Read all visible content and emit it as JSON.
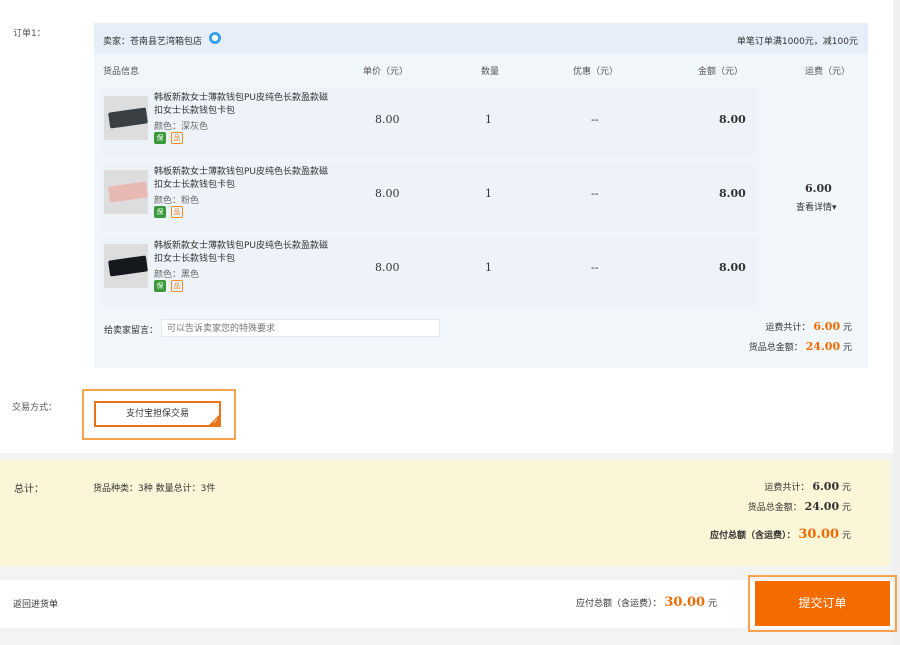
{
  "order": {
    "label": "订单1：",
    "seller": "卖家：苍南县艺湾箱包店",
    "promo": "单笔订单满1000元，减100元",
    "headers": {
      "info": "货品信息",
      "unit_price": "单价（元）",
      "quantity": "数量",
      "discount": "优惠（元）",
      "amount": "金额（元）",
      "shipping": "运费（元）"
    },
    "items": [
      {
        "title": "韩板新款女士薄款钱包PU皮纯色长款盈款磁扣女士长款钱包卡包",
        "attr": "颜色：深灰色",
        "badge1": "保",
        "badge2": "品",
        "unit_price": "8.00",
        "quantity": "1",
        "discount": "--",
        "amount": "8.00",
        "wallet_color": "#3a3f44"
      },
      {
        "title": "韩板新款女士薄款钱包PU皮纯色长款盈款磁扣女士长款钱包卡包",
        "attr": "颜色：粉色",
        "badge1": "保",
        "badge2": "品",
        "unit_price": "8.00",
        "quantity": "1",
        "discount": "--",
        "amount": "8.00",
        "wallet_color": "#e8b8b4"
      },
      {
        "title": "韩板新款女士薄款钱包PU皮纯色长款盈款磁扣女士长款钱包卡包",
        "attr": "颜色：黑色",
        "badge1": "保",
        "badge2": "品",
        "unit_price": "8.00",
        "quantity": "1",
        "discount": "--",
        "amount": "8.00",
        "wallet_color": "#15181c"
      }
    ],
    "shipping_value": "6.00",
    "shipping_detail": "查看详情",
    "message_label": "给卖家留言：",
    "message_placeholder": "可以告诉卖家您的特殊要求",
    "shipping_total_label": "运费共计：",
    "shipping_total": "6.00",
    "goods_total_label": "货品总金额：",
    "goods_total": "24.00",
    "unit": "元"
  },
  "trade": {
    "label": "交易方式：",
    "option": "支付宝担保交易"
  },
  "total": {
    "label": "总计：",
    "counts": "货品种类：3种   数量总计：3件",
    "shipping_label": "运费共计：",
    "shipping": "6.00",
    "goods_label": "货品总金额：",
    "goods": "24.00",
    "payable_label": "应付总额（含运费）：",
    "payable": "30.00",
    "unit": "元"
  },
  "footer": {
    "back": "返回进货单",
    "pay_label": "应付总额（含运费）：",
    "pay_amount": "30.00",
    "unit": "元",
    "submit": "提交订单"
  },
  "colors": {
    "accent": "#f46b00",
    "orange_text": "#f06a00"
  }
}
